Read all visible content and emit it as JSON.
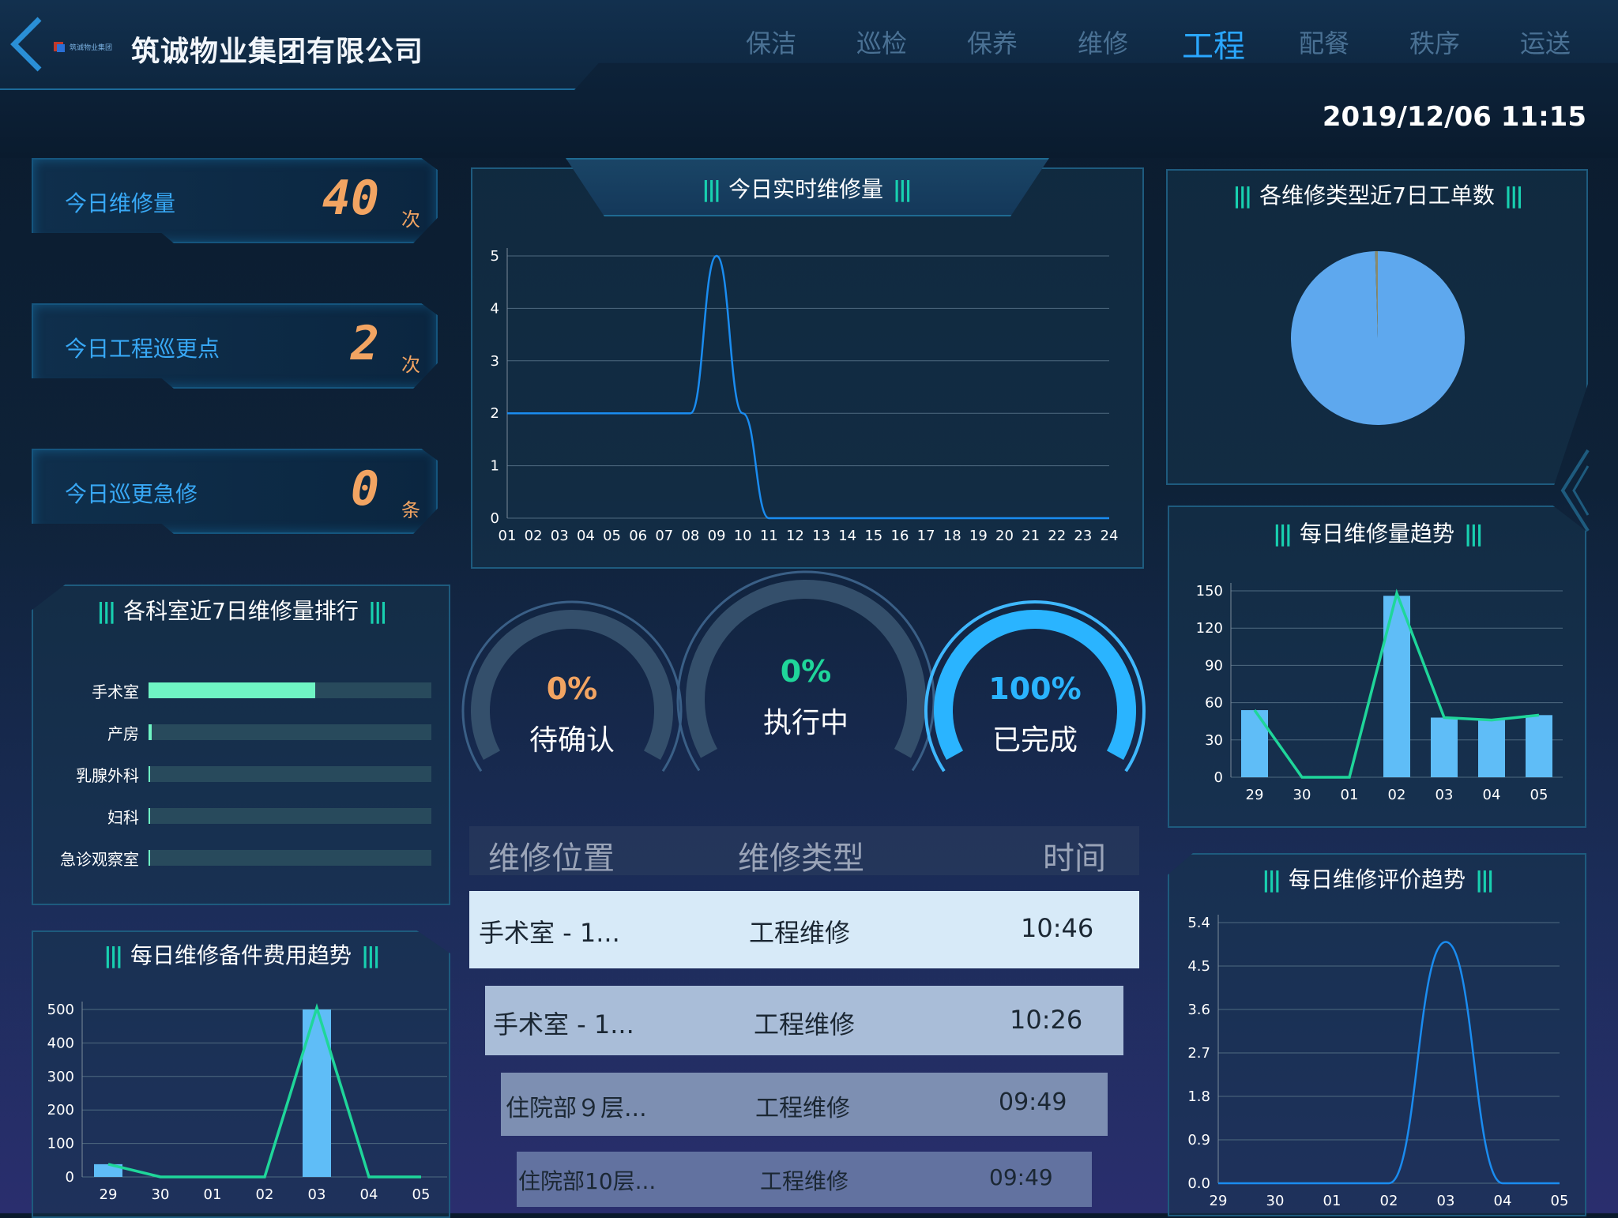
{
  "header": {
    "company": "筑诚物业集团有限公司",
    "logo_text": "筑诚物业集团",
    "datetime": "2019/12/06 11:15",
    "nav": [
      "保洁",
      "巡检",
      "保养",
      "维修",
      "工程",
      "配餐",
      "秩序",
      "运送"
    ],
    "active_nav": "工程"
  },
  "stats": [
    {
      "label": "今日维修量",
      "value": "40",
      "unit": "次"
    },
    {
      "label": "今日工程巡更点",
      "value": "2",
      "unit": "次"
    },
    {
      "label": "今日巡更急修",
      "value": "0",
      "unit": "条"
    }
  ],
  "ranking": {
    "title": "各科室近7日维修量排行",
    "items": [
      {
        "name": "手术室",
        "fraction": 0.59
      },
      {
        "name": "产房",
        "fraction": 0.01
      },
      {
        "name": "乳腺外科",
        "fraction": 0.005
      },
      {
        "name": "妇科",
        "fraction": 0.005
      },
      {
        "name": "急诊观察室",
        "fraction": 0.005
      }
    ]
  },
  "gauges": [
    {
      "pct": "0%",
      "label": "待确认",
      "color": "#f2a462"
    },
    {
      "pct": "0%",
      "label": "执行中",
      "color": "#1fd69a"
    },
    {
      "pct": "100%",
      "label": "已完成",
      "color": "#2ab4ff"
    }
  ],
  "table": {
    "headers": [
      "维修位置",
      "维修类型",
      "时间"
    ],
    "rows": [
      {
        "location": "手术室 - 1...",
        "type": "工程维修",
        "time": "10:46"
      },
      {
        "location": "手术室 - 1...",
        "type": "工程维修",
        "time": "10:26"
      },
      {
        "location": "住院部９层...",
        "type": "工程维修",
        "time": "09:49"
      },
      {
        "location": "住院部10层...",
        "type": "工程维修",
        "time": "09:49"
      }
    ]
  },
  "colors": {
    "accent": "#2aa7ff",
    "bar": "#5fbdf7",
    "line": "#1fd69a",
    "orange": "#f2a462"
  },
  "chart_data": [
    {
      "id": "realtime",
      "type": "line",
      "title": "今日实时维修量",
      "x": [
        "01",
        "02",
        "03",
        "04",
        "05",
        "06",
        "07",
        "08",
        "09",
        "10",
        "11",
        "12",
        "13",
        "14",
        "15",
        "16",
        "17",
        "18",
        "19",
        "20",
        "21",
        "22",
        "23",
        "24"
      ],
      "series": [
        {
          "values": [
            2,
            2,
            2,
            2,
            2,
            2,
            2,
            2,
            5,
            2,
            0,
            0,
            0,
            0,
            0,
            0,
            0,
            0,
            0,
            0,
            0,
            0,
            0,
            0
          ]
        }
      ],
      "yticks": [
        0,
        1,
        2,
        3,
        4,
        5
      ],
      "ylim": [
        0,
        5
      ],
      "grid": true
    },
    {
      "id": "pie",
      "type": "pie",
      "title": "各维修类型近7日工单数",
      "slices": [
        {
          "value": 99.5,
          "color": "#5ea8ee"
        },
        {
          "value": 0.5,
          "color": "#8a8a6a"
        }
      ]
    },
    {
      "id": "daily",
      "type": "bar",
      "title": "每日维修量趋势",
      "categories": [
        "29",
        "30",
        "01",
        "02",
        "03",
        "04",
        "05"
      ],
      "values": [
        54,
        0,
        0,
        146,
        48,
        46,
        50
      ],
      "line_values": [
        54,
        0,
        0,
        148,
        48,
        46,
        50
      ],
      "yticks": [
        0,
        30,
        60,
        90,
        120,
        150
      ],
      "ylim": [
        0,
        150
      ]
    },
    {
      "id": "cost",
      "type": "bar",
      "title": "每日维修备件费用趋势",
      "categories": [
        "29",
        "30",
        "01",
        "02",
        "03",
        "04",
        "05"
      ],
      "values": [
        38,
        0,
        0,
        0,
        500,
        0,
        0
      ],
      "line_values": [
        38,
        0,
        0,
        0,
        505,
        0,
        0
      ],
      "yticks": [
        0,
        100,
        200,
        300,
        400,
        500
      ],
      "ylim": [
        0,
        500
      ]
    },
    {
      "id": "rating",
      "type": "line",
      "title": "每日维修评价趋势",
      "x": [
        "29",
        "30",
        "01",
        "02",
        "03",
        "04",
        "05"
      ],
      "series": [
        {
          "values": [
            0,
            0,
            0,
            0,
            5,
            0,
            0
          ]
        }
      ],
      "yticks": [
        "0.0",
        "0.9",
        "1.8",
        "2.7",
        "3.6",
        "4.5",
        "5.4"
      ],
      "ylim": [
        0,
        5.4
      ]
    }
  ]
}
